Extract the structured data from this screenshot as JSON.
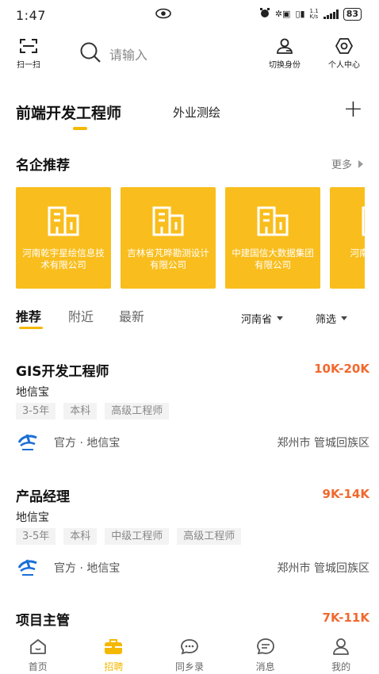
{
  "status_bar": {
    "time": "1:47",
    "battery": "83",
    "net_speed_top": "1.1",
    "net_speed_bottom": "K/s"
  },
  "header": {
    "scan_label": "扫一扫",
    "search_placeholder": "请输入",
    "switch_label": "切换身份",
    "me_label": "个人中心"
  },
  "job_tabs": {
    "active": "前端开发工程师",
    "other": "外业测绘",
    "add_icon": "plus-icon"
  },
  "companies": {
    "title": "名企推荐",
    "more": "更多",
    "items": [
      {
        "name": "河南乾宇星绘信息技术有限公司"
      },
      {
        "name": "吉林省芃晔勘测设计有限公司"
      },
      {
        "name": "中建国信大数据集团有限公司"
      },
      {
        "name": "河南省…调…"
      }
    ]
  },
  "filters": {
    "tabs": [
      "推荐",
      "附近",
      "最新"
    ],
    "province": "河南省",
    "filter": "筛选"
  },
  "jobs": [
    {
      "title": "GIS开发工程师",
      "salary": "10K-20K",
      "company": "地信宝",
      "tags": [
        "3-5年",
        "本科",
        "高级工程师"
      ],
      "official": "官方 · 地信宝",
      "location": "郑州市 管城回族区"
    },
    {
      "title": "产品经理",
      "salary": "9K-14K",
      "company": "地信宝",
      "tags": [
        "3-5年",
        "本科",
        "中级工程师",
        "高级工程师"
      ],
      "official": "官方 · 地信宝",
      "location": "郑州市 管城回族区"
    },
    {
      "title": "项目主管",
      "salary": "7K-11K"
    }
  ],
  "bottom_nav": [
    {
      "label": "首页",
      "icon": "home-icon"
    },
    {
      "label": "招聘",
      "icon": "briefcase-icon"
    },
    {
      "label": "同乡录",
      "icon": "chat-bubble-icon"
    },
    {
      "label": "消息",
      "icon": "message-icon"
    },
    {
      "label": "我的",
      "icon": "person-icon"
    }
  ],
  "colors": {
    "accent": "#f5b800",
    "card": "#f9be1d",
    "salary": "#f2682d"
  }
}
